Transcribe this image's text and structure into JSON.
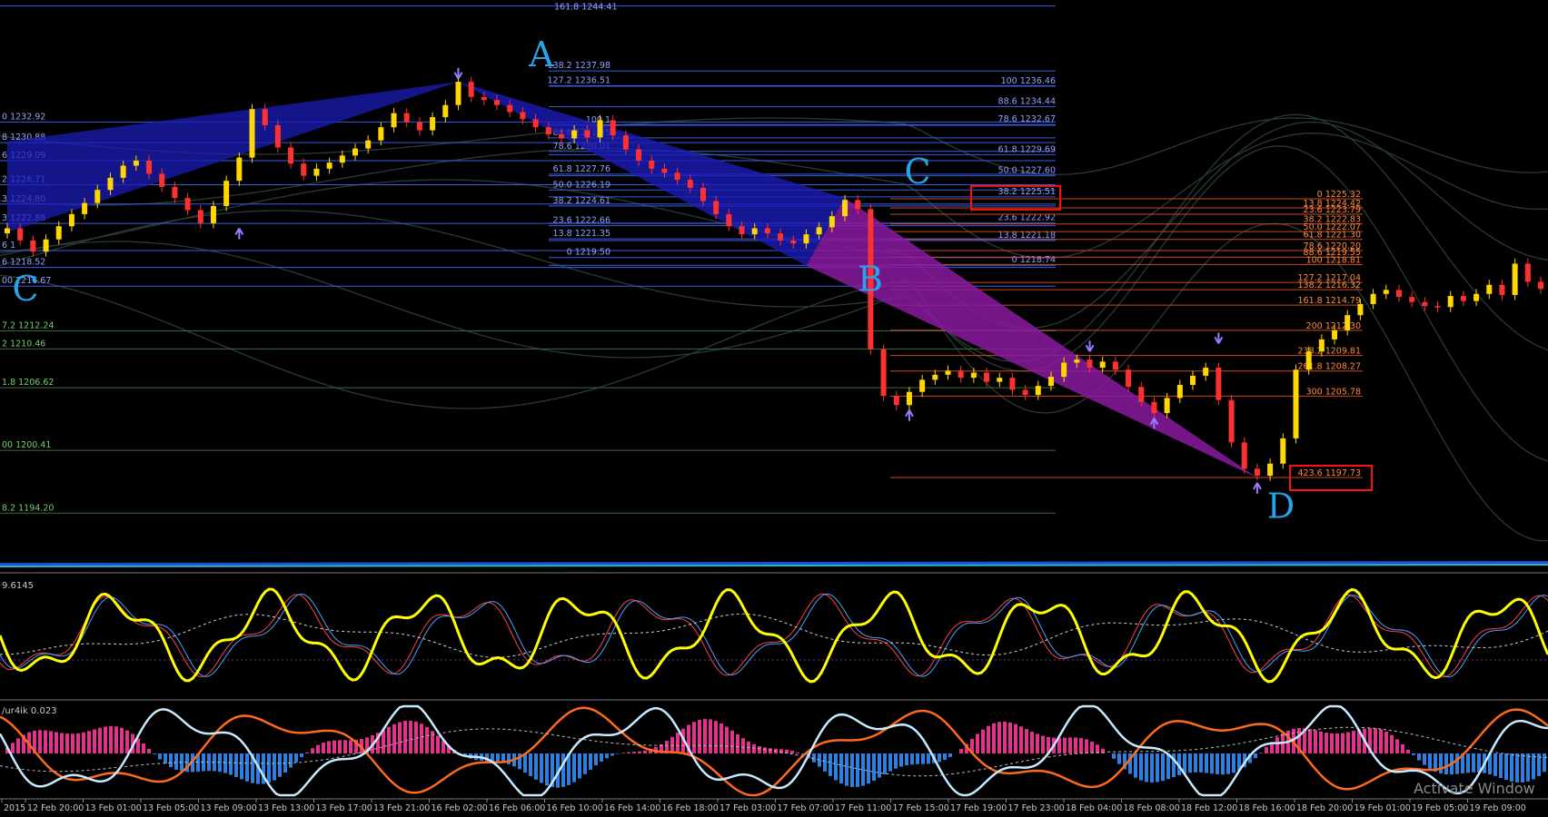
{
  "chart_data": {
    "type": "candlestick",
    "symbol": "",
    "ylim": [
      1190,
      1245
    ],
    "colors": {
      "bull": "#ffd700",
      "bear": "#ff3030",
      "fib_blue": "#3b5bdc",
      "fib_label_blue": "#8fa2ff",
      "fib_orange": "#c84a1e",
      "fib_label_orange": "#ff8a3a",
      "fib_green": "#6fd06f",
      "bat_leg1": "#1c1cb8",
      "bat_leg2": "#8a1aa0",
      "highlight_box": "#ff1010",
      "point_label": "#29a3e6",
      "osc_main": "#ffff00",
      "osc_red": "#ff4040",
      "osc_blue": "#4aa0ff",
      "hist_pos": "#e0338a",
      "hist_neg": "#2f7fe0",
      "line_light": "#c6eaff",
      "line_orange": "#ff6a1a"
    },
    "price_series": [
      1222.4,
      1221.2,
      1220.1,
      1221.3,
      1222.6,
      1223.8,
      1224.9,
      1226.2,
      1227.4,
      1228.6,
      1229.1,
      1227.8,
      1226.5,
      1225.4,
      1224.2,
      1222.9,
      1224.6,
      1227.1,
      1229.4,
      1234.2,
      1232.6,
      1230.4,
      1228.8,
      1227.6,
      1228.3,
      1228.9,
      1229.6,
      1230.3,
      1231.1,
      1232.4,
      1233.8,
      1232.9,
      1232.1,
      1233.4,
      1234.6,
      1236.9,
      1235.4,
      1235.1,
      1234.6,
      1233.9,
      1233.2,
      1232.4,
      1231.7,
      1231.3,
      1232.1,
      1231.4,
      1233.1,
      1231.6,
      1230.2,
      1229.1,
      1228.3,
      1227.9,
      1227.2,
      1226.4,
      1225.1,
      1223.8,
      1222.6,
      1221.8,
      1222.4,
      1221.9,
      1221.2,
      1220.9,
      1221.8,
      1222.5,
      1223.6,
      1225.2,
      1224.3,
      1210.4,
      1205.8,
      1204.9,
      1206.2,
      1207.4,
      1207.9,
      1208.3,
      1207.6,
      1208.1,
      1207.2,
      1207.6,
      1206.4,
      1205.9,
      1206.8,
      1207.7,
      1209.1,
      1209.4,
      1208.6,
      1209.2,
      1208.4,
      1206.7,
      1205.2,
      1204.1,
      1205.6,
      1206.9,
      1207.8,
      1208.6,
      1205.4,
      1201.2,
      1198.6,
      1197.9,
      1199.1,
      1201.6,
      1208.4,
      1210.2,
      1211.4,
      1212.3,
      1213.8,
      1214.9,
      1215.9,
      1216.3,
      1215.6,
      1215.1,
      1214.7,
      1214.6,
      1215.7,
      1215.2,
      1215.9,
      1216.8,
      1215.8,
      1218.9,
      1217.1,
      1216.4
    ],
    "harmonic_points": [
      {
        "label": "A",
        "price": 1236.9
      },
      {
        "label": "B",
        "price": 1218.7
      },
      {
        "label": "C",
        "price": 1225.4
      },
      {
        "label": "D",
        "price": 1197.7
      }
    ],
    "fib_left": [
      "0 1232.92",
      "8 1230.88",
      "6 1229.09",
      "2 1226.71",
      "3 1224.80",
      "3 1222.88",
      "6 1",
      "6 1218.52",
      "00 1216.67",
      "7.2 1212.24",
      "2 1210.46",
      "1.8 1206.62",
      "00 1200.41",
      "8.2 1194.20"
    ],
    "fib_middle": [
      "138.2 1237.98",
      "127.2 1236.51",
      "100 1",
      "88.6 1231.35",
      "78.6 1230.01",
      "61.8 1227.76",
      "50.0 1226.19",
      "38.2 1224.61",
      "23.6 1222.66",
      "13.8 1221.35",
      "0 1219.50"
    ],
    "fib_right_blue": [
      "100 1236.46",
      "88.6 1234.44",
      "78.6 1232.67",
      "61.8 1229.69",
      "50.0 1227.60",
      "38.2 1225.51",
      "23.6 1222.92",
      "13.8 1221.18",
      "0 1218.74"
    ],
    "fib_right_orange": [
      "0 1225.32",
      "13.8 1224.42",
      "23.6 1223.79",
      "38.2 1222.83",
      "50.0 1222.07",
      "61.8 1221.30",
      "78.6 1220.20",
      "88.6 1219.55",
      "100 1218.81",
      "127.2 1217.04",
      "138.2 1216.32",
      "161.8 1214.79",
      "200 1212.30",
      "238.2 1209.81",
      "261.8 1208.27",
      "300 1205.78",
      "423.6 1197.73"
    ],
    "top_partial_label": "161.8 1244.41",
    "upper_indicator_label": "9.6145",
    "lower_indicator_label": "/ur4ik 0.023",
    "x_tick_labels": [
      "2015",
      "12 Feb 20:00",
      "13 Feb 01:00",
      "13 Feb 05:00",
      "13 Feb 09:00",
      "13 Feb 13:00",
      "13 Feb 17:00",
      "13 Feb 21:00",
      "16 Feb 02:00",
      "16 Feb 06:00",
      "16 Feb 10:00",
      "16 Feb 14:00",
      "16 Feb 18:00",
      "17 Feb 03:00",
      "17 Feb 07:00",
      "17 Feb 11:00",
      "17 Feb 15:00",
      "17 Feb 19:00",
      "17 Feb 23:00",
      "18 Feb 04:00",
      "18 Feb 08:00",
      "18 Feb 12:00",
      "18 Feb 16:00",
      "18 Feb 20:00",
      "19 Feb 01:00",
      "19 Feb 05:00",
      "19 Feb 09:00"
    ],
    "watermark": "Activate Window"
  }
}
